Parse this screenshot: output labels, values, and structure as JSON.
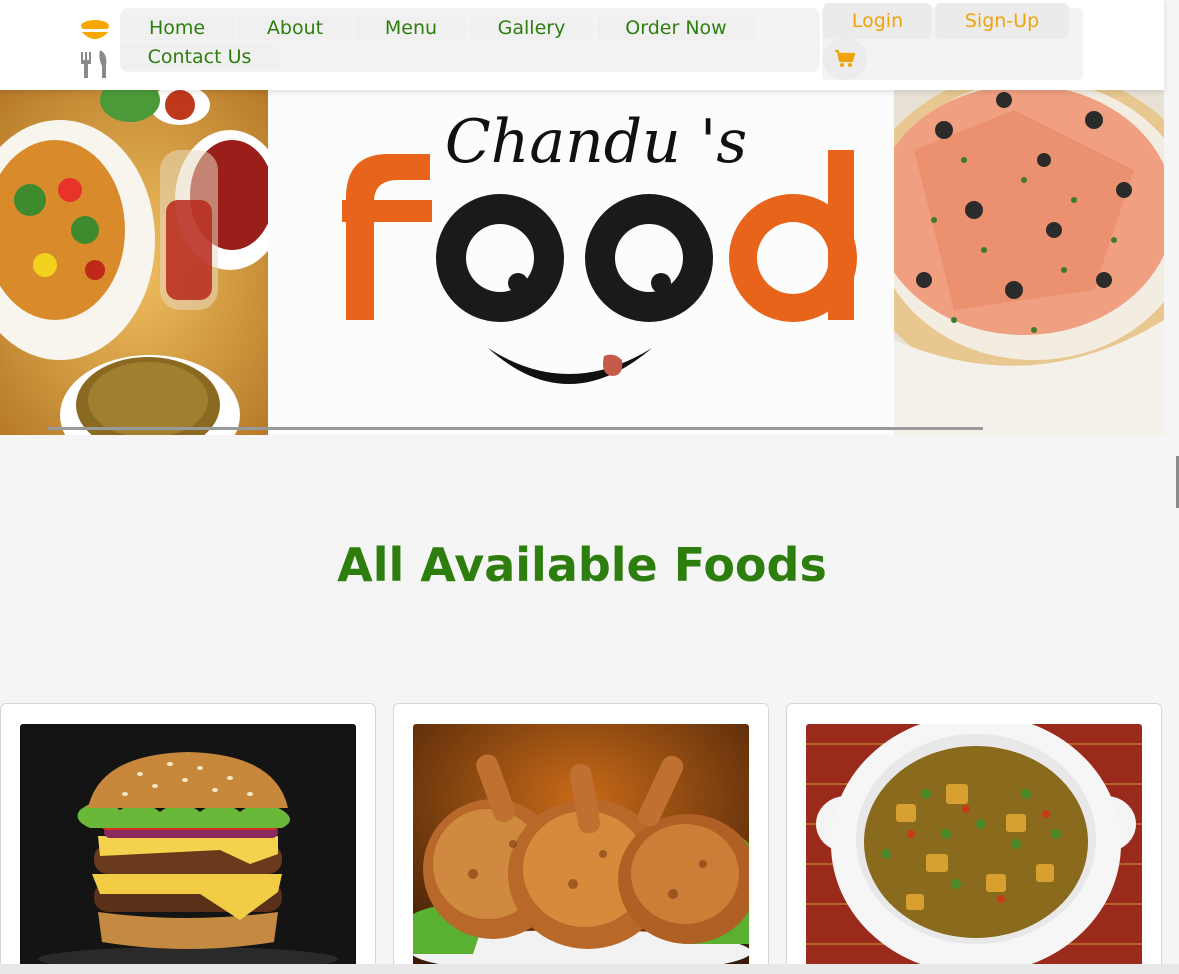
{
  "nav": {
    "links": [
      {
        "label": "Home"
      },
      {
        "label": "About"
      },
      {
        "label": "Menu"
      },
      {
        "label": "Gallery"
      },
      {
        "label": "Order Now"
      },
      {
        "label": "Contact Us"
      }
    ],
    "login_label": "Login",
    "signup_label": "Sign-Up",
    "cart_icon": "shopping-cart-icon"
  },
  "hero": {
    "brand_script": "Chandu 's",
    "brand_word": "food"
  },
  "section": {
    "title": "All Available Foods"
  },
  "foods": [
    {
      "image": "burger"
    },
    {
      "image": "roasted-chicken"
    },
    {
      "image": "vegetable-curry"
    }
  ],
  "colors": {
    "nav_green": "#2e7d0f",
    "accent_orange": "#f0a30a",
    "brand_orange": "#e8641a",
    "title_green": "#2e7d0f"
  }
}
